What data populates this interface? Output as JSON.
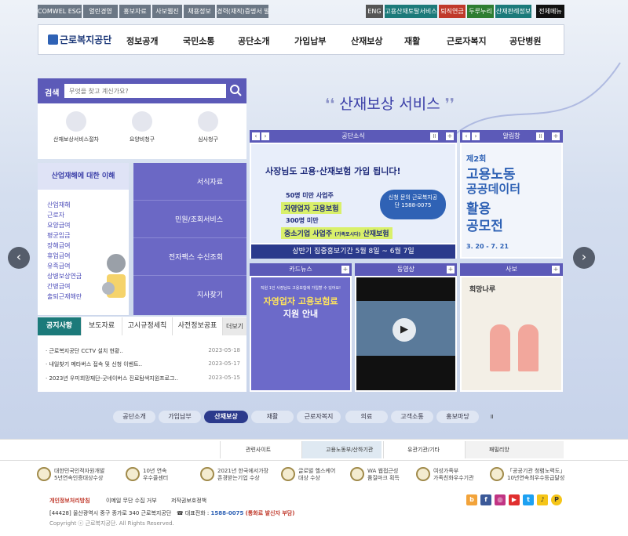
{
  "util_left": [
    "COMWEL ESG경영",
    "열린경영",
    "홍보자료",
    "사보웹진",
    "채용정보",
    "경력(재직)증명서 발급"
  ],
  "util_right": {
    "eng": "ENG",
    "portal": "고용산재토탈서비스",
    "pension": "퇴직연금",
    "durunuri": "두루누리",
    "info": "산재판례정보",
    "all": "전체메뉴"
  },
  "brand": "근로복지공단",
  "gnb": [
    "정보공개",
    "국민소통",
    "공단소개",
    "가입납부",
    "산재보상",
    "재활",
    "근로자복지",
    "공단병원"
  ],
  "search": {
    "label": "검색",
    "placeholder": "무엇을 찾고 계신가요?"
  },
  "quick": [
    "산재보상서비스절차",
    "요양비청구",
    "심사청구"
  ],
  "service_title": "산재보상 서비스",
  "understand": {
    "title": "산업재해에 대한 이해",
    "links": [
      "산업재해",
      "근로자",
      "요양급여",
      "평균임금",
      "장해급여",
      "휴업급여",
      "유족급여",
      "상병보상연금",
      "간병급여",
      "출퇴근재해란"
    ]
  },
  "side_buttons": [
    "서식자료",
    "민원/조회서비스",
    "전자팩스 수신조회",
    "지사찾기"
  ],
  "panels": {
    "news": "공단소식",
    "notice": "알림창",
    "card": "카드뉴스",
    "video": "동영상",
    "magazine": "사보"
  },
  "banner": {
    "line1": "사장님도 고용·산재보험 가입 됩니다!",
    "a": "50명 미만 사업주",
    "b": "자영업자 고용보험",
    "c": "300명 미만",
    "d": "중소기업 사업주",
    "d2": "(가족포시다)",
    "e": "산재보험",
    "contact": "신청 문의 근로복지공단 1588-0075",
    "footer": "상반기 집중홍보기간 5월 8일 ~ 6월 7일"
  },
  "notice_banner": {
    "round": "제2회",
    "l1": "고용노동",
    "l2": "공공데이터",
    "l3": "활용",
    "l4": "공모전",
    "date": "3. 20 - 7. 21"
  },
  "card_news": {
    "top": "직원 1인 사장님도 고용보험에 가입할 수 있어요!",
    "l1": "자영업자 고용보험료",
    "l2": "지원 안내"
  },
  "magazine_title": "희망나루",
  "tabs": [
    "공지사항",
    "보도자료",
    "고시규정세칙",
    "사전정보공표"
  ],
  "more": "더보기",
  "news_list": [
    {
      "t": "근로복지공단 CCTV 설치 현황..",
      "d": "2023-05-18"
    },
    {
      "t": "내일찾기 메타버스 접속 및 신청 이벤트..",
      "d": "2023-05-17"
    },
    {
      "t": "2023년 우미희망재단-굿네이버스 진료탐색지원프로그..",
      "d": "2023-05-15"
    }
  ],
  "pills": [
    "공단소개",
    "가입납부",
    "산재보상",
    "재활",
    "근로자복지",
    "의료",
    "고객소통",
    "홍보마당"
  ],
  "related": [
    "관련사이트",
    "고용노동부/산하기관",
    "유관기관/기타",
    "패밀리앙"
  ],
  "awards": [
    "대한민국인적자원개발\n5년연속인증대상수상",
    "10년 연속\n우수콜센터",
    "2021년 한국에서가장\n존경받는기업 수상",
    "글로벌 헬스케어\n대상 수상",
    "WA 웹접근성\n품질마크 획득",
    "여성가족부\n가족친화우수기관",
    "「공공기관 청렴노력도」\n10년연속최우수등급달성"
  ],
  "footer": {
    "privacy": "개인정보처리방침",
    "email": "이메일 무단 수집 거부",
    "copy": "저작권보호정책",
    "addr": "[44428] 울산광역시 중구 종가로 340 근로복지공단",
    "tel_label": "대표전화 :",
    "tel": "1588-0075",
    "tel_note": "(통화료 발신자 부담)",
    "copyright": "Copyright ⓒ 근로복지공단. All Rights Reserved."
  },
  "sns": [
    "b",
    "f",
    "◎",
    "▶",
    "t",
    "♪",
    "P"
  ],
  "colors": {
    "purple": "#5c5ab8",
    "teal": "#1c7a7a",
    "blue": "#2f62b5"
  }
}
